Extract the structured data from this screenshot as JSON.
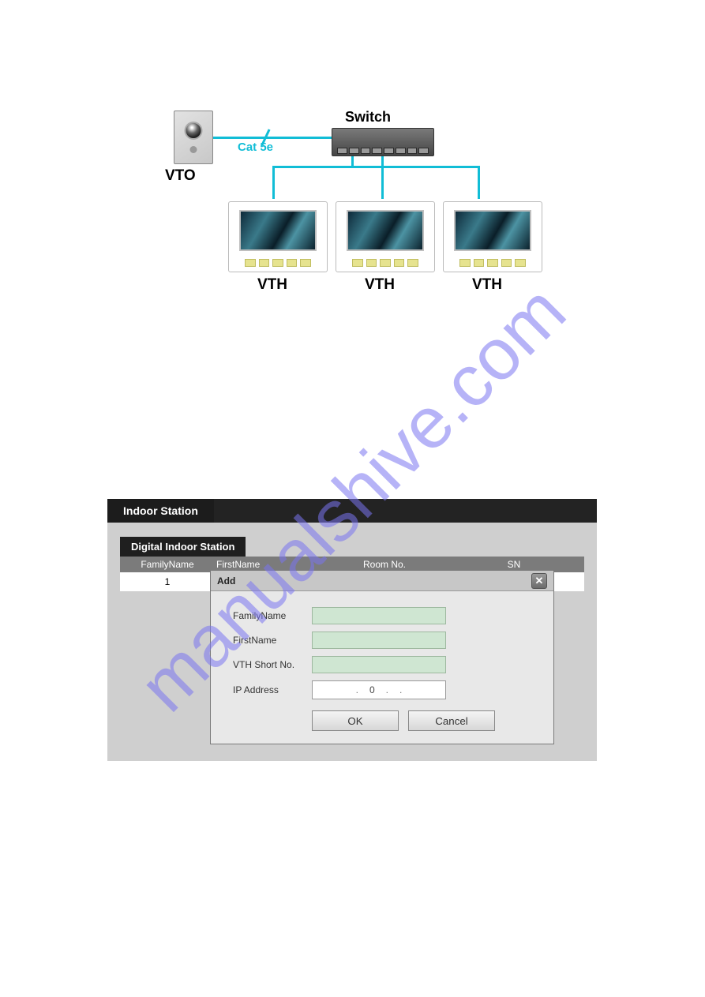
{
  "watermark": "manualshive.com",
  "diagram": {
    "vto_label": "VTO",
    "switch_label": "Switch",
    "cable_label": "Cat 5e",
    "vth_label": "VTH"
  },
  "app": {
    "title_tab": "Indoor Station",
    "subtab": "Digital Indoor Station",
    "columns": {
      "family": "FamilyName",
      "first": "FirstName",
      "room": "Room No.",
      "sn": "SN"
    },
    "row1_index": "1",
    "dialog": {
      "title": "Add",
      "close": "✕",
      "labels": {
        "family": "FamilyName",
        "first": "FirstName",
        "short": "VTH Short No.",
        "ip": "IP Address"
      },
      "ip_value": "0",
      "ip_dot": ".",
      "ok": "OK",
      "cancel": "Cancel"
    }
  }
}
